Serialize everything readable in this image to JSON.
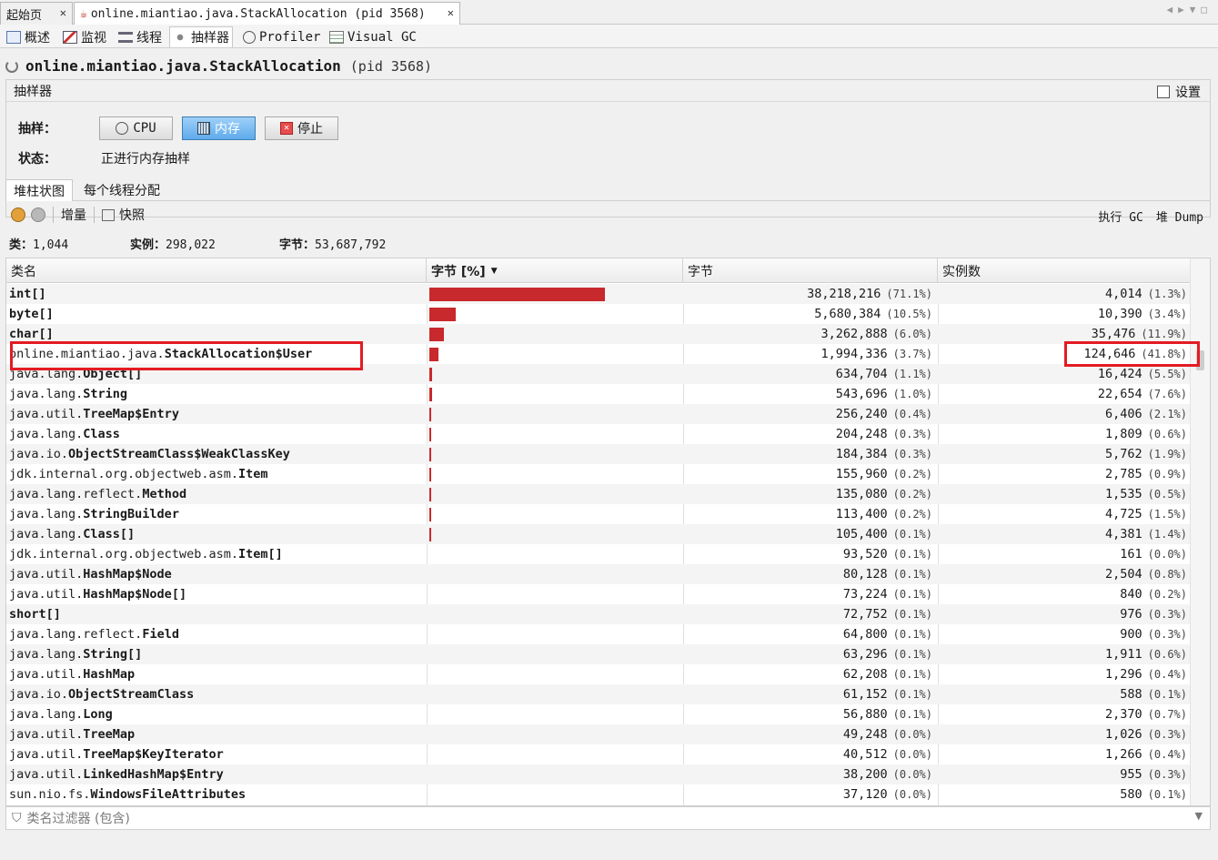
{
  "tabs": {
    "home": "起始页",
    "process": "online.miantiao.java.StackAllocation (pid 3568)"
  },
  "subtabs": [
    "概述",
    "监视",
    "线程",
    "抽样器",
    "Profiler",
    "Visual GC"
  ],
  "app": {
    "name": "online.miantiao.java.StackAllocation",
    "pid": "(pid 3568)"
  },
  "sampler": {
    "label": "抽样器",
    "settings": "设置",
    "sample_label": "抽样：",
    "state_label": "状态：",
    "cpu_button": "CPU",
    "memory_button": "内存",
    "stop_button": "停止",
    "state_value": "正进行内存抽样"
  },
  "view_tabs": {
    "heap_histogram": "堆柱状图",
    "per_thread": "每个线程分配"
  },
  "toolbar": {
    "delta": "增量",
    "snapshot": "快照",
    "perform_gc": "执行 GC",
    "heap_dump": "堆 Dump"
  },
  "stats": {
    "classes_label": "类：",
    "classes_value": "1,044",
    "instances_label": "实例：",
    "instances_value": "298,022",
    "bytes_label": "字节：",
    "bytes_value": "53,687,792"
  },
  "table": {
    "headers": {
      "name": "类名",
      "bytes_pct": "字节 [%]",
      "bytes": "字节",
      "instances": "实例数"
    },
    "rows": [
      {
        "pkg": "",
        "cls": "int[]",
        "bytes": "38,218,216",
        "bytes_pct": "(71.1%)",
        "bar": 71.1,
        "instances": "4,014",
        "inst_pct": "(1.3%)"
      },
      {
        "pkg": "",
        "cls": "byte[]",
        "bytes": "5,680,384",
        "bytes_pct": "(10.5%)",
        "bar": 10.5,
        "instances": "10,390",
        "inst_pct": "(3.4%)"
      },
      {
        "pkg": "",
        "cls": "char[]",
        "bytes": "3,262,888",
        "bytes_pct": "(6.0%)",
        "bar": 6.0,
        "instances": "35,476",
        "inst_pct": "(11.9%)"
      },
      {
        "pkg": "online.miantiao.java.",
        "cls": "StackAllocation$User",
        "bytes": "1,994,336",
        "bytes_pct": "(3.7%)",
        "bar": 3.7,
        "instances": "124,646",
        "inst_pct": "(41.8%)"
      },
      {
        "pkg": "java.lang.",
        "cls": "Object[]",
        "bytes": "634,704",
        "bytes_pct": "(1.1%)",
        "bar": 1.1,
        "instances": "16,424",
        "inst_pct": "(5.5%)"
      },
      {
        "pkg": "java.lang.",
        "cls": "String",
        "bytes": "543,696",
        "bytes_pct": "(1.0%)",
        "bar": 1.0,
        "instances": "22,654",
        "inst_pct": "(7.6%)"
      },
      {
        "pkg": "java.util.",
        "cls": "TreeMap$Entry",
        "bytes": "256,240",
        "bytes_pct": "(0.4%)",
        "bar": 0.4,
        "instances": "6,406",
        "inst_pct": "(2.1%)"
      },
      {
        "pkg": "java.lang.",
        "cls": "Class",
        "bytes": "204,248",
        "bytes_pct": "(0.3%)",
        "bar": 0.3,
        "instances": "1,809",
        "inst_pct": "(0.6%)"
      },
      {
        "pkg": "java.io.",
        "cls": "ObjectStreamClass$WeakClassKey",
        "bytes": "184,384",
        "bytes_pct": "(0.3%)",
        "bar": 0.3,
        "instances": "5,762",
        "inst_pct": "(1.9%)"
      },
      {
        "pkg": "jdk.internal.org.objectweb.asm.",
        "cls": "Item",
        "bytes": "155,960",
        "bytes_pct": "(0.2%)",
        "bar": 0.2,
        "instances": "2,785",
        "inst_pct": "(0.9%)"
      },
      {
        "pkg": "java.lang.reflect.",
        "cls": "Method",
        "bytes": "135,080",
        "bytes_pct": "(0.2%)",
        "bar": 0.2,
        "instances": "1,535",
        "inst_pct": "(0.5%)"
      },
      {
        "pkg": "java.lang.",
        "cls": "StringBuilder",
        "bytes": "113,400",
        "bytes_pct": "(0.2%)",
        "bar": 0.2,
        "instances": "4,725",
        "inst_pct": "(1.5%)"
      },
      {
        "pkg": "java.lang.",
        "cls": "Class[]",
        "bytes": "105,400",
        "bytes_pct": "(0.1%)",
        "bar": 0.1,
        "instances": "4,381",
        "inst_pct": "(1.4%)"
      },
      {
        "pkg": "jdk.internal.org.objectweb.asm.",
        "cls": "Item[]",
        "bytes": "93,520",
        "bytes_pct": "(0.1%)",
        "bar": 0,
        "instances": "161",
        "inst_pct": "(0.0%)"
      },
      {
        "pkg": "java.util.",
        "cls": "HashMap$Node",
        "bytes": "80,128",
        "bytes_pct": "(0.1%)",
        "bar": 0,
        "instances": "2,504",
        "inst_pct": "(0.8%)"
      },
      {
        "pkg": "java.util.",
        "cls": "HashMap$Node[]",
        "bytes": "73,224",
        "bytes_pct": "(0.1%)",
        "bar": 0,
        "instances": "840",
        "inst_pct": "(0.2%)"
      },
      {
        "pkg": "",
        "cls": "short[]",
        "bytes": "72,752",
        "bytes_pct": "(0.1%)",
        "bar": 0,
        "instances": "976",
        "inst_pct": "(0.3%)"
      },
      {
        "pkg": "java.lang.reflect.",
        "cls": "Field",
        "bytes": "64,800",
        "bytes_pct": "(0.1%)",
        "bar": 0,
        "instances": "900",
        "inst_pct": "(0.3%)"
      },
      {
        "pkg": "java.lang.",
        "cls": "String[]",
        "bytes": "63,296",
        "bytes_pct": "(0.1%)",
        "bar": 0,
        "instances": "1,911",
        "inst_pct": "(0.6%)"
      },
      {
        "pkg": "java.util.",
        "cls": "HashMap",
        "bytes": "62,208",
        "bytes_pct": "(0.1%)",
        "bar": 0,
        "instances": "1,296",
        "inst_pct": "(0.4%)"
      },
      {
        "pkg": "java.io.",
        "cls": "ObjectStreamClass",
        "bytes": "61,152",
        "bytes_pct": "(0.1%)",
        "bar": 0,
        "instances": "588",
        "inst_pct": "(0.1%)"
      },
      {
        "pkg": "java.lang.",
        "cls": "Long",
        "bytes": "56,880",
        "bytes_pct": "(0.1%)",
        "bar": 0,
        "instances": "2,370",
        "inst_pct": "(0.7%)"
      },
      {
        "pkg": "java.util.",
        "cls": "TreeMap",
        "bytes": "49,248",
        "bytes_pct": "(0.0%)",
        "bar": 0,
        "instances": "1,026",
        "inst_pct": "(0.3%)"
      },
      {
        "pkg": "java.util.",
        "cls": "TreeMap$KeyIterator",
        "bytes": "40,512",
        "bytes_pct": "(0.0%)",
        "bar": 0,
        "instances": "1,266",
        "inst_pct": "(0.4%)"
      },
      {
        "pkg": "java.util.",
        "cls": "LinkedHashMap$Entry",
        "bytes": "38,200",
        "bytes_pct": "(0.0%)",
        "bar": 0,
        "instances": "955",
        "inst_pct": "(0.3%)"
      },
      {
        "pkg": "sun.nio.fs.",
        "cls": "WindowsFileAttributes",
        "bytes": "37,120",
        "bytes_pct": "(0.0%)",
        "bar": 0,
        "instances": "580",
        "inst_pct": "(0.1%)"
      }
    ]
  },
  "filter": {
    "placeholder": "类名过滤器 (包含)"
  },
  "colors": {
    "bar": "#c8292c",
    "highlight": "#e31b23",
    "pressed_button": "#5eaaec"
  }
}
